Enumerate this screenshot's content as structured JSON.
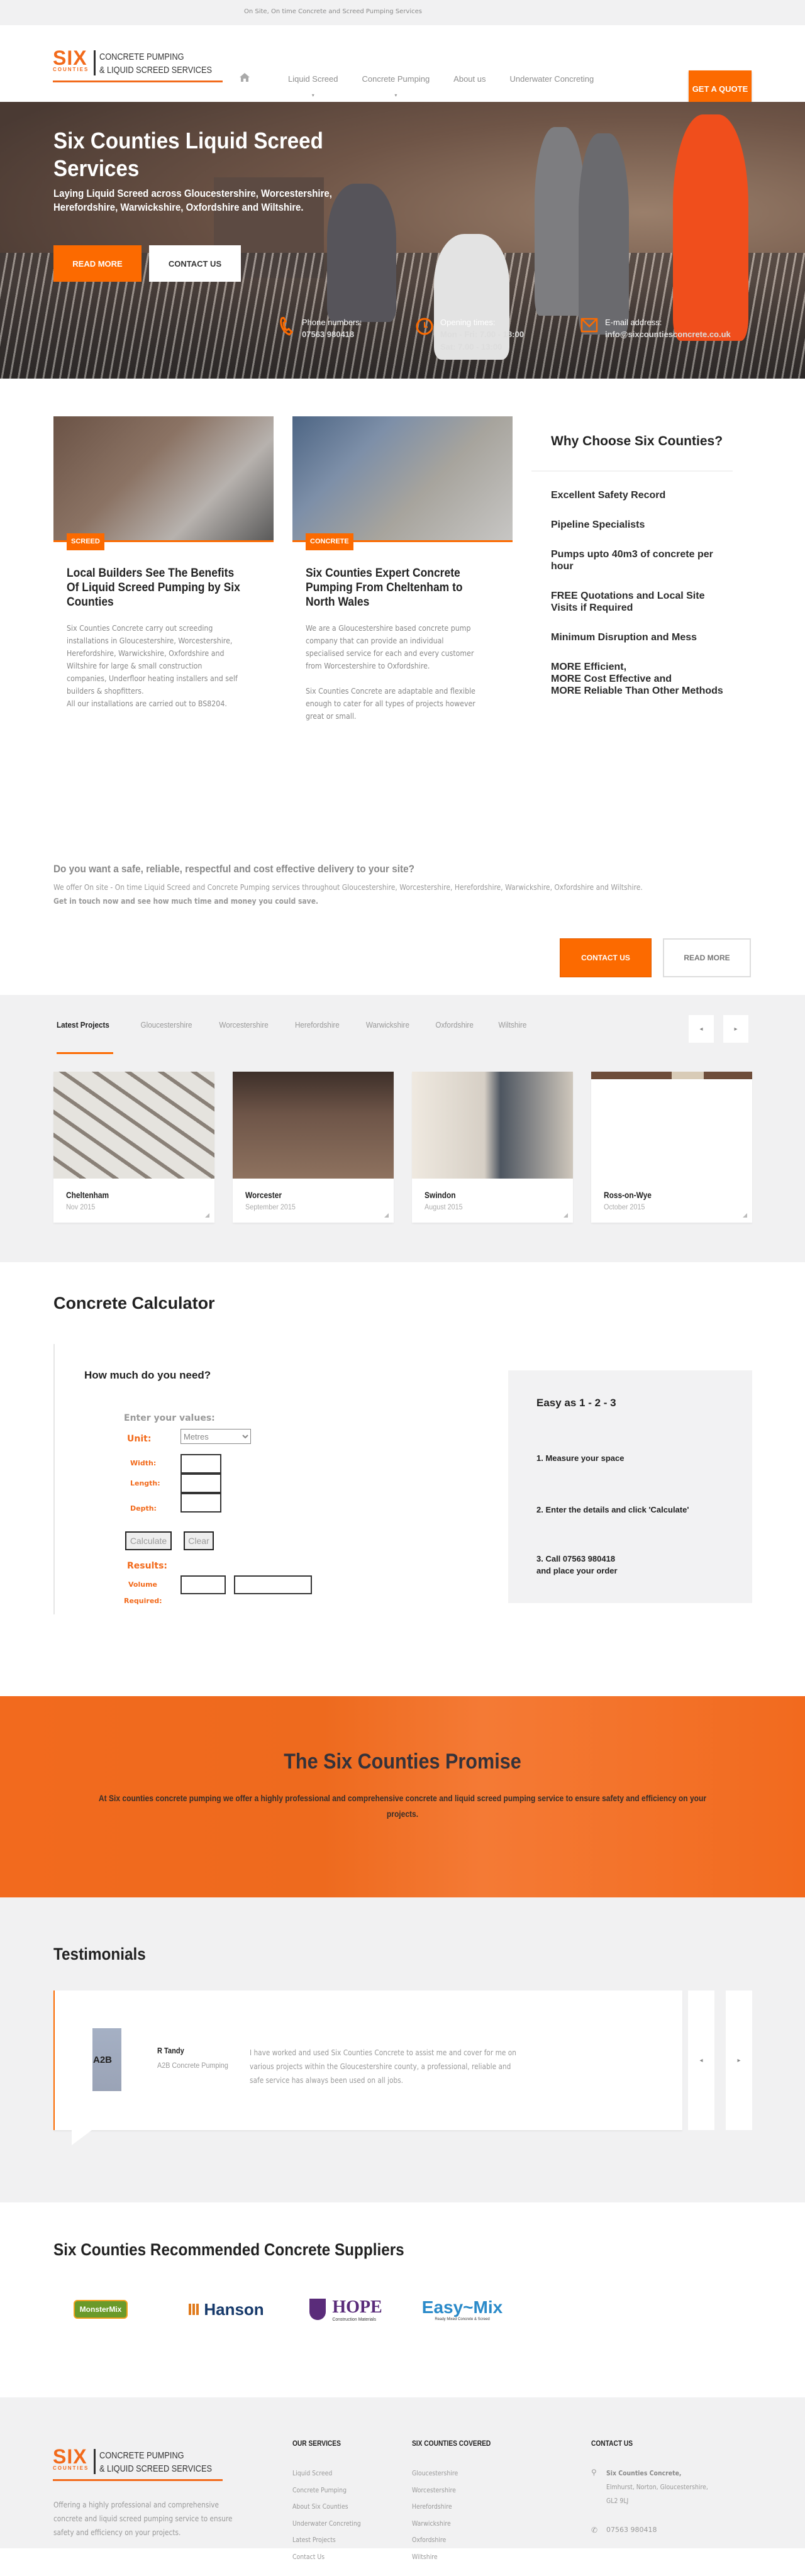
{
  "topbar": {
    "tagline": "On Site, On time Concrete and Screed Pumping Services"
  },
  "logo": {
    "six": "SIX",
    "counties": "COUNTIES",
    "line1": "CONCRETE PUMPING",
    "line2": "& LIQUID SCREED SERVICES"
  },
  "nav": {
    "home_icon": "home-icon",
    "items": [
      {
        "label": "Liquid Screed",
        "has_dropdown": true
      },
      {
        "label": "Concrete Pumping",
        "has_dropdown": true
      },
      {
        "label": "About us",
        "has_dropdown": false
      },
      {
        "label": "Underwater Concreting",
        "has_dropdown": false
      }
    ],
    "caret": "▾",
    "quote_button": "GET A QUOTE"
  },
  "hero": {
    "title": "Six Counties Liquid Screed Services",
    "subtitle": "Laying Liquid Screed across Gloucestershire, Worcestershire, Herefordshire, Warwickshire, Oxfordshire and Wiltshire.",
    "read_more": "READ MORE",
    "contact_us": "CONTACT US",
    "info": [
      {
        "icon": "phone-icon",
        "label": "Phone numbers:",
        "values": [
          "07563 980418"
        ]
      },
      {
        "icon": "clock-icon",
        "label": "Opening times:",
        "values": [
          "Mon - Fri: 7.00 - 18:00",
          "Sat: 7.00 - 13:00"
        ]
      },
      {
        "icon": "mail-icon",
        "label": "E-mail address:",
        "values": [
          "info@sixcountiesconcrete.co.uk"
        ]
      }
    ]
  },
  "articles": [
    {
      "tag": "SCREED",
      "title": "Local Builders See The Benefits Of Liquid Screed Pumping by Six Counties",
      "body": "Six Counties Concrete carry out screeding installations in Gloucestershire, Worcestershire, Herefordshire, Warwickshire, Oxfordshire and Wiltshire for large & small construction companies, Underfloor heating installers and self builders & shopfitters.",
      "body2": "All our installations are carried out to BS8204."
    },
    {
      "tag": "CONCRETE",
      "title": "Six Counties Expert Concrete Pumping From Cheltenham to North Wales",
      "body": "We are a Gloucestershire based concrete pump company that can provide an individual specialised service for each and every customer from Worcestershire to Oxfordshire.",
      "body2": "Six Counties Concrete are adaptable and flexible enough to cater for all types of projects however great or small."
    }
  ],
  "why": {
    "title": "Why Choose Six Counties?",
    "items": [
      "Excellent Safety Record",
      "Pipeline Specialists",
      "Pumps upto 40m3 of concrete per hour",
      "FREE Quotations and Local Site Visits if Required",
      "Minimum Disruption and Mess",
      "MORE Efficient,\nMORE Cost Effective and\nMORE Reliable Than Other Methods"
    ]
  },
  "cta": {
    "heading": "Do you want a safe, reliable, respectful and cost effective delivery to your site?",
    "text": "We offer On site - On time Liquid Screed and Concrete Pumping services throughout Gloucestershire, Worcestershire, Herefordshire, Warwickshire, Oxfordshire and Wiltshire.",
    "bold": "Get in touch now and see how much time and money you could save.",
    "contact": "CONTACT US",
    "read_more": "READ MORE"
  },
  "projects": {
    "tabs": [
      "Latest Projects",
      "Gloucestershire",
      "Worcestershire",
      "Herefordshire",
      "Warwickshire",
      "Oxfordshire",
      "Wiltshire"
    ],
    "active_tab": 0,
    "prev": "◂",
    "next": "▸",
    "items": [
      {
        "title": "Cheltenham",
        "date": "Nov 2015"
      },
      {
        "title": "Worcester",
        "date": "September 2015"
      },
      {
        "title": "Swindon",
        "date": "August 2015"
      },
      {
        "title": "Ross-on-Wye",
        "date": "October 2015"
      }
    ]
  },
  "calculator": {
    "title": "Concrete Calculator",
    "question": "How much do you need?",
    "enter_values": "Enter your values:",
    "unit_label": "Unit:",
    "unit_value": "Metres",
    "width_label": "Width:",
    "length_label": "Length:",
    "depth_label": "Depth:",
    "width_value": "",
    "length_value": "",
    "depth_value": "",
    "calculate": "Calculate",
    "clear": "Clear",
    "results_label": "Results:",
    "volume_label": "Volume Required:",
    "volume_value": "",
    "volume_unit": "",
    "steps_title": "Easy as 1 - 2 - 3",
    "steps": [
      "1. Measure your space",
      "2. Enter the details and click 'Calculate'",
      "3. Call 07563 980418\nand place your order"
    ]
  },
  "promise": {
    "title": "The Six Counties Promise",
    "text": "At Six counties concrete pumping we offer a highly professional and comprehensive concrete and liquid screed pumping service to ensure safety and efficiency on your projects."
  },
  "testimonials": {
    "title": "Testimonials",
    "items": [
      {
        "avatar_text": "A2B",
        "name": "R Tandy",
        "company": "A2B Concrete Pumping",
        "quote": "I have worked and used Six Counties Concrete to assist me and cover for me on various projects within the Gloucestershire county, a professional, reliable and safe service has always been used on all jobs."
      }
    ],
    "prev": "◂",
    "next": "▸"
  },
  "suppliers": {
    "title": "Six Counties Recommended Concrete Suppliers",
    "items": [
      {
        "name": "Monster Mix Concrete",
        "text": "MonsterMix"
      },
      {
        "name": "Hanson",
        "text": "Hanson"
      },
      {
        "name": "HOPE Construction Materials",
        "text": "HOPE",
        "sub": "Construction Materials"
      },
      {
        "name": "Easy Mix",
        "text": "Easy~Mix",
        "sub": "Ready Mixed Concrete & Screed"
      }
    ]
  },
  "footer": {
    "description": "Offering a highly professional and comprehensive concrete and liquid screed pumping service to ensure safety and efficiency on your projects.",
    "services_title": "OUR SERVICES",
    "services": [
      "Liquid Screed",
      "Concrete Pumping",
      "About Six Counties",
      "Underwater Concreting",
      "Latest Projects",
      "Contact Us"
    ],
    "counties_title": "SIX COUNTIES COVERED",
    "counties": [
      "Gloucestershire",
      "Worcestershire",
      "Herefordshire",
      "Warwickshire",
      "Oxfordshire",
      "Wiltshire"
    ],
    "contact_title": "CONTACT US",
    "address_name": "Six Counties Concrete,",
    "address_lines": "Elmhurst, Norton, Gloucestershire, GL2 9LJ",
    "phone": "07563 980418"
  },
  "colors": {
    "accent": "#fc6a00",
    "dark": "#222222",
    "muted": "#999999",
    "panel": "#f1f1f2"
  }
}
